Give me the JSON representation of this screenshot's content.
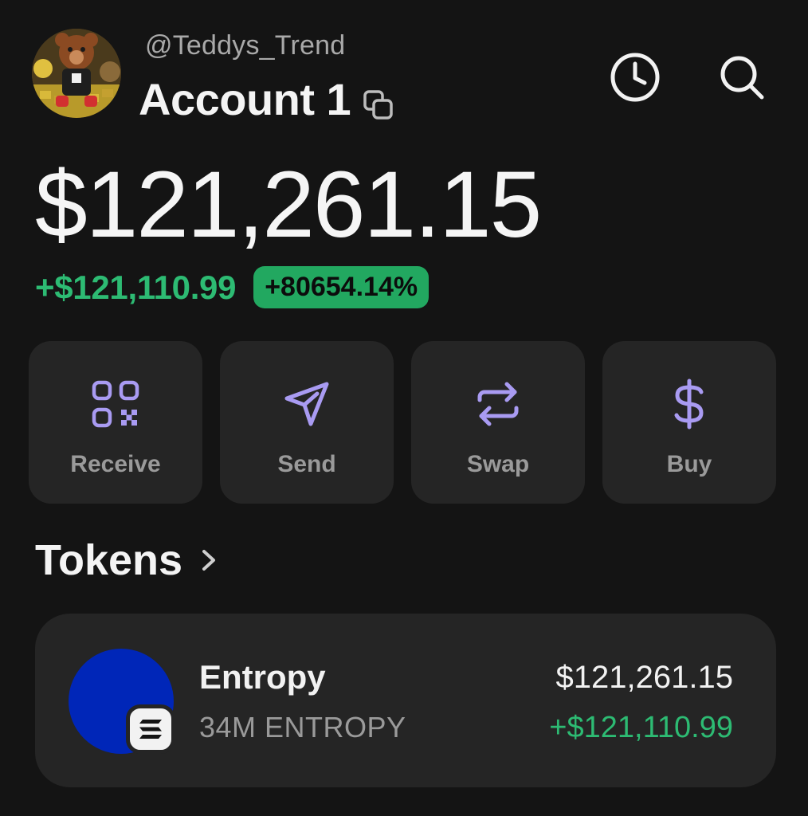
{
  "header": {
    "handle": "@Teddys_Trend",
    "account_name": "Account 1"
  },
  "balance": {
    "total": "$121,261.15",
    "change_amount": "+$121,110.99",
    "change_percent": "+80654.14%"
  },
  "actions": [
    {
      "label": "Receive",
      "icon": "qr-code-icon"
    },
    {
      "label": "Send",
      "icon": "paper-plane-icon"
    },
    {
      "label": "Swap",
      "icon": "swap-arrows-icon"
    },
    {
      "label": "Buy",
      "icon": "dollar-icon"
    }
  ],
  "tokens": {
    "title": "Tokens",
    "items": [
      {
        "name": "Entropy",
        "amount": "34M ENTROPY",
        "value": "$121,261.15",
        "change": "+$121,110.99",
        "logo_color": "#0026b8"
      }
    ]
  },
  "colors": {
    "background": "#141414",
    "card": "#252525",
    "accent_purple": "#a99bf2",
    "positive_green": "#2dbb73"
  }
}
